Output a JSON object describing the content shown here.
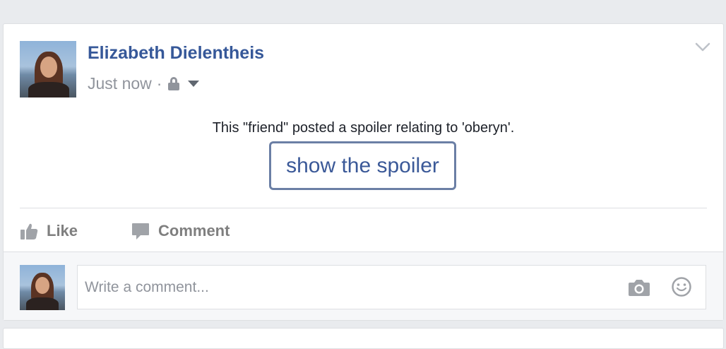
{
  "post": {
    "author": "Elizabeth Dielentheis",
    "timestamp": "Just now",
    "separator": "·",
    "privacy_icon": "lock-icon",
    "audience_menu_icon": "caret-down-icon",
    "options_icon": "chevron-down-icon",
    "spoiler_notice": "This \"friend\" posted a spoiler relating to 'oberyn'.",
    "spoiler_button": "show the spoiler"
  },
  "actions": {
    "like_label": "Like",
    "like_icon": "thumbs-up-icon",
    "comment_label": "Comment",
    "comment_icon": "speech-bubble-icon"
  },
  "comment_box": {
    "placeholder": "Write a comment...",
    "photo_icon": "camera-icon",
    "emoji_icon": "smiley-icon"
  },
  "colors": {
    "link_blue": "#365899",
    "button_text": "#3b5998",
    "muted_gray": "#90949c",
    "background": "#e9ebee"
  }
}
